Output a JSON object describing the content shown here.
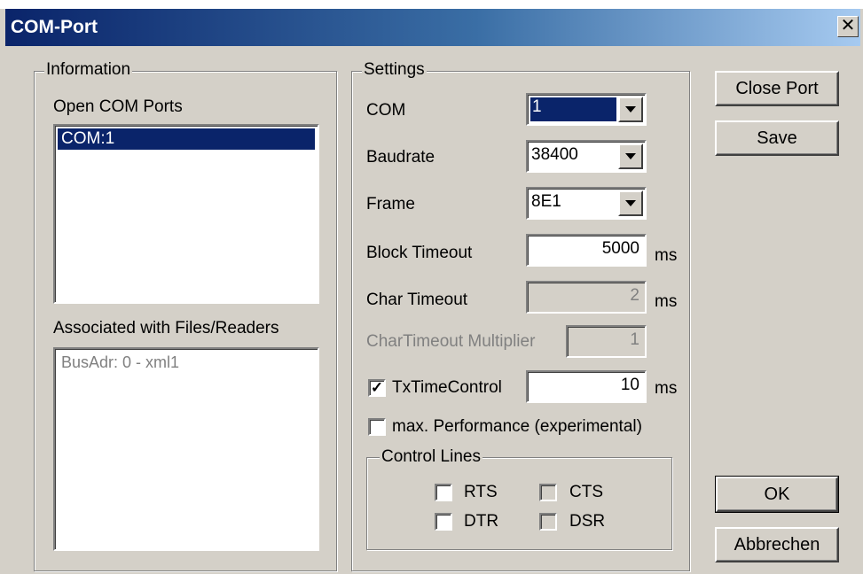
{
  "window": {
    "title": "COM-Port",
    "close_glyph": "✕"
  },
  "information": {
    "legend": "Information",
    "open_ports_label": "Open COM Ports",
    "open_ports": [
      "COM:1"
    ],
    "associated_label": "Associated with Files/Readers",
    "associated_items": [
      "BusAdr:  0 - xml1"
    ]
  },
  "settings": {
    "legend": "Settings",
    "com": {
      "label": "COM",
      "value": "1"
    },
    "baudrate": {
      "label": "Baudrate",
      "value": "38400"
    },
    "frame": {
      "label": "Frame",
      "value": "8E1"
    },
    "block_timeout": {
      "label": "Block Timeout",
      "value": "5000",
      "unit": "ms"
    },
    "char_timeout": {
      "label": "Char Timeout",
      "value": "2",
      "unit": "ms"
    },
    "char_timeout_multiplier": {
      "label": "CharTimeout Multiplier",
      "value": "1"
    },
    "tx_time_control": {
      "label": "TxTimeControl",
      "checked": true,
      "value": "10",
      "unit": "ms"
    },
    "max_performance": {
      "label": "max. Performance (experimental)",
      "checked": false
    },
    "control_lines": {
      "legend": "Control Lines",
      "rts": {
        "label": "RTS",
        "checked": false
      },
      "cts": {
        "label": "CTS",
        "checked": false
      },
      "dtr": {
        "label": "DTR",
        "checked": false
      },
      "dsr": {
        "label": "DSR",
        "checked": false
      }
    }
  },
  "buttons": {
    "close_port": "Close Port",
    "save": "Save",
    "ok": "OK",
    "cancel": "Abbrechen"
  },
  "check_glyph": "✓",
  "colors": {
    "title_start": "#0a246a",
    "title_end": "#a6caf0",
    "face": "#d4d0c8",
    "selection": "#0a246a"
  }
}
